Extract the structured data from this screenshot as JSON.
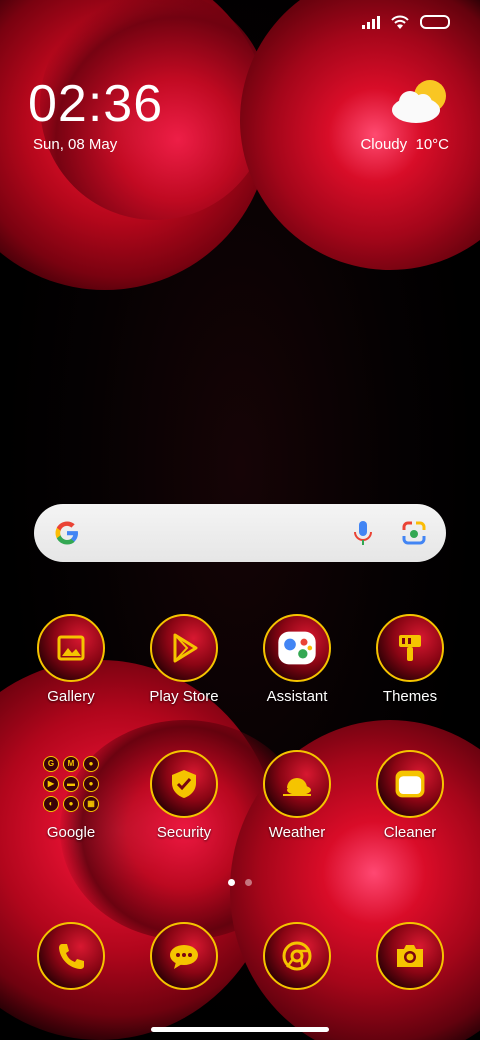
{
  "status_bar": {
    "icons": [
      "signal-icon",
      "wifi-icon",
      "battery-icon"
    ]
  },
  "clock": {
    "time": "02:36",
    "date": "Sun, 08 May"
  },
  "weather": {
    "condition": "Cloudy",
    "temperature": "10°C",
    "icon": "cloud-sun-icon"
  },
  "search": {
    "icons": [
      "google-logo-icon",
      "microphone-icon",
      "lens-icon"
    ]
  },
  "apps": {
    "row1": [
      {
        "label": "Gallery",
        "icon": "gallery-icon"
      },
      {
        "label": "Play Store",
        "icon": "play-store-icon"
      },
      {
        "label": "Assistant",
        "icon": "assistant-icon"
      },
      {
        "label": "Themes",
        "icon": "paintbrush-icon"
      }
    ],
    "row2": [
      {
        "label": "Google",
        "icon": "folder-icon"
      },
      {
        "label": "Security",
        "icon": "shield-check-icon"
      },
      {
        "label": "Weather",
        "icon": "weather-icon"
      },
      {
        "label": "Cleaner",
        "icon": "cleaner-icon"
      }
    ]
  },
  "folder_items": [
    "G",
    "M",
    "●",
    "▶",
    "▬",
    "●",
    "◐",
    "●",
    "▦"
  ],
  "dock": [
    {
      "icon": "phone-icon"
    },
    {
      "icon": "messages-icon"
    },
    {
      "icon": "chrome-icon"
    },
    {
      "icon": "camera-icon"
    }
  ],
  "page_indicator": {
    "count": 2,
    "active": 1
  },
  "colors": {
    "accent": "#f5c400",
    "rose": "#c8081f",
    "background": "#000000"
  }
}
